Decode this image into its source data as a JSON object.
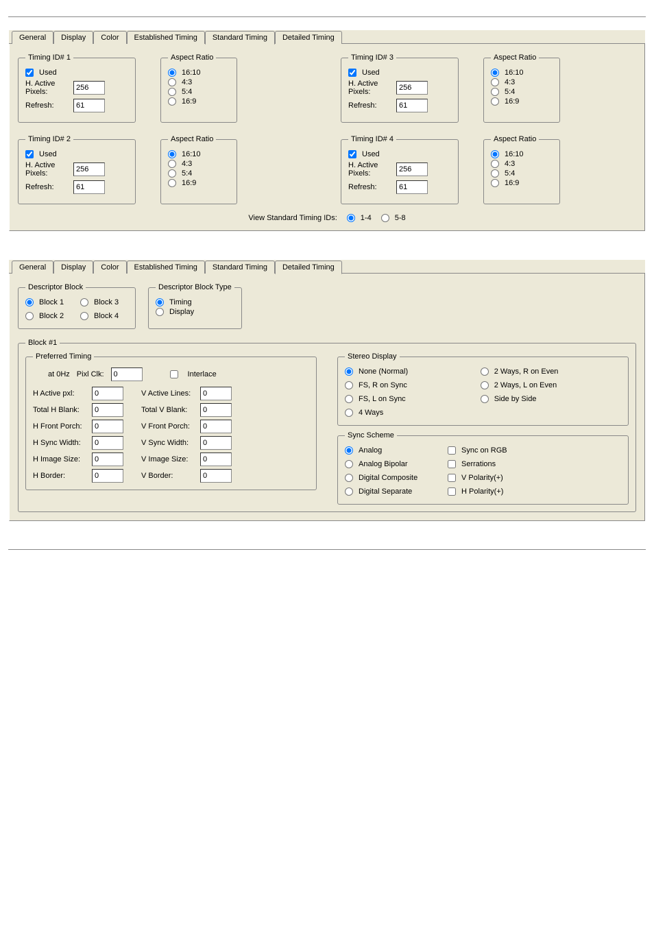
{
  "tabs": [
    "General",
    "Display",
    "Color",
    "Established Timing",
    "Standard Timing",
    "Detailed Timing"
  ],
  "panel1": {
    "activeTab": "Standard Timing"
  },
  "panel2": {
    "activeTab": "Detailed Timing"
  },
  "aspect_options": [
    "16:10",
    "4:3",
    "5:4",
    "16:9"
  ],
  "timing": [
    {
      "title": "Timing ID# 1",
      "used": true,
      "hActive": "256",
      "refresh": "61",
      "aspect": "16:10"
    },
    {
      "title": "Timing ID# 2",
      "used": true,
      "hActive": "256",
      "refresh": "61",
      "aspect": "16:10"
    },
    {
      "title": "Timing ID# 3",
      "used": true,
      "hActive": "256",
      "refresh": "61",
      "aspect": "16:10"
    },
    {
      "title": "Timing ID# 4",
      "used": true,
      "hActive": "256",
      "refresh": "61",
      "aspect": "16:10"
    }
  ],
  "labels": {
    "used": "Used",
    "hActive": "H. Active Pixels:",
    "refresh": "Refresh:",
    "aspect": "Aspect Ratio",
    "viewStd": "View Standard Timing IDs:",
    "viewOpt1": "1-4",
    "viewOpt2": "5-8"
  },
  "viewStdSel": "1-4",
  "descriptorBlock": {
    "title": "Descriptor Block",
    "options": [
      "Block 1",
      "Block 2",
      "Block 3",
      "Block 4"
    ],
    "selected": "Block 1"
  },
  "descriptorType": {
    "title": "Descriptor Block Type",
    "options": [
      "Timing",
      "Display"
    ],
    "selected": "Timing"
  },
  "block1": {
    "title": "Block #1",
    "preferredTitle": "Preferred Timing",
    "atHz": "at 0Hz",
    "pixClkLabel": "Pixl Clk:",
    "pixClk": "0",
    "interlace": "Interlace",
    "interlaceChecked": false,
    "rowsLeft": [
      {
        "label": "H Active pxl:",
        "value": "0"
      },
      {
        "label": "Total H Blank:",
        "value": "0"
      },
      {
        "label": "H Front Porch:",
        "value": "0"
      },
      {
        "label": "H Sync Width:",
        "value": "0"
      },
      {
        "label": "H Image Size:",
        "value": "0"
      },
      {
        "label": "H Border:",
        "value": "0"
      }
    ],
    "rowsRight": [
      {
        "label": "V Active Lines:",
        "value": "0"
      },
      {
        "label": "Total V Blank:",
        "value": "0"
      },
      {
        "label": "V Front Porch:",
        "value": "0"
      },
      {
        "label": "V Sync Width:",
        "value": "0"
      },
      {
        "label": "V Image Size:",
        "value": "0"
      },
      {
        "label": "V Border:",
        "value": "0"
      }
    ]
  },
  "stereo": {
    "title": "Stereo Display",
    "options": [
      "None (Normal)",
      "FS, R on Sync",
      "FS, L on Sync",
      "4 Ways",
      "2 Ways, R on Even",
      "2 Ways, L on Even",
      "Side by Side"
    ],
    "selected": "None (Normal)"
  },
  "syncScheme": {
    "title": "Sync Scheme",
    "radios": [
      "Analog",
      "Analog Bipolar",
      "Digital Composite",
      "Digital Separate"
    ],
    "radioSelected": "Analog",
    "checks": [
      {
        "label": "Sync on RGB",
        "checked": false
      },
      {
        "label": "Serrations",
        "checked": false
      },
      {
        "label": "V Polarity(+)",
        "checked": false
      },
      {
        "label": "H Polarity(+)",
        "checked": false
      }
    ]
  }
}
